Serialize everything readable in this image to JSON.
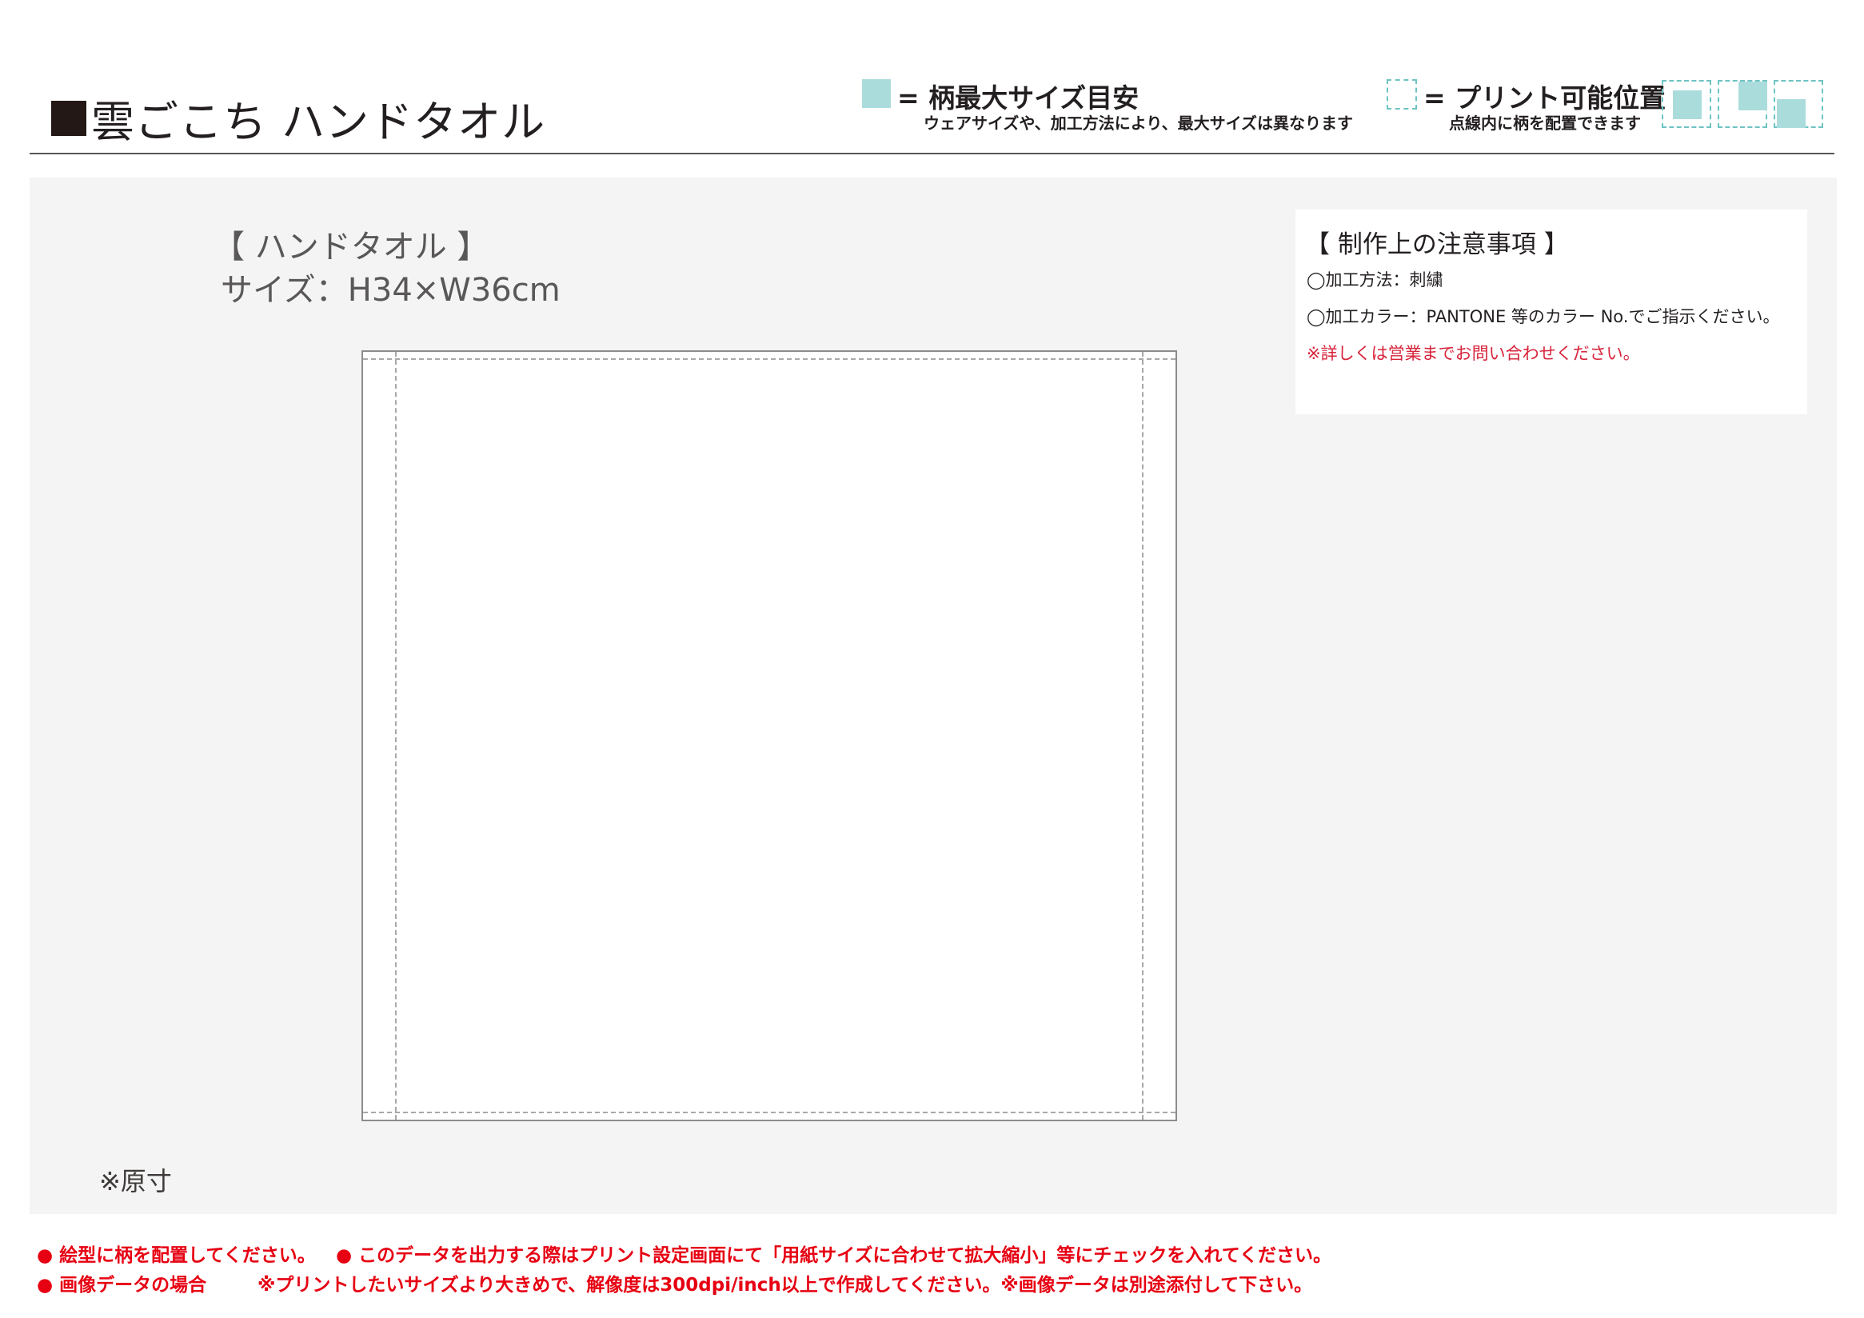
{
  "header": {
    "title": "雲ごこち ハンドタオル",
    "legend_max_size": {
      "label": "= 柄最大サイズ目安",
      "note": "ウェアサイズや、加工方法により、最大サイズは異なります",
      "swatch_color": "#abdcdc"
    },
    "legend_print_area": {
      "label": "= プリント可能位置",
      "note": "点線内に柄を配置できます",
      "border_color": "#6ec3c3"
    }
  },
  "product": {
    "name": "【 ハンドタオル 】",
    "size": "サイズ：H34×W36cm",
    "original_size_note": "※原寸"
  },
  "notes": {
    "title": "【 制作上の注意事項 】",
    "method": "◯加工方法：刺繍",
    "color": "◯加工カラー：PANTONE 等のカラー No.でご指示ください。",
    "contact": "※詳しくは営業までお問い合わせください。"
  },
  "footer": {
    "line1_a": "● 絵型に柄を配置してください。",
    "line1_b": "● このデータを出力する際はプリント設定画面にて「用紙サイズに合わせて拡大縮小」等にチェックを入れてください。",
    "line2_a": "● 画像データの場合",
    "line2_b": "※プリントしたいサイズより大きめで、解像度は300dpi/inch以上で作成してください。※画像データは別途添付して下さい。",
    "text_color": "#e60012"
  }
}
